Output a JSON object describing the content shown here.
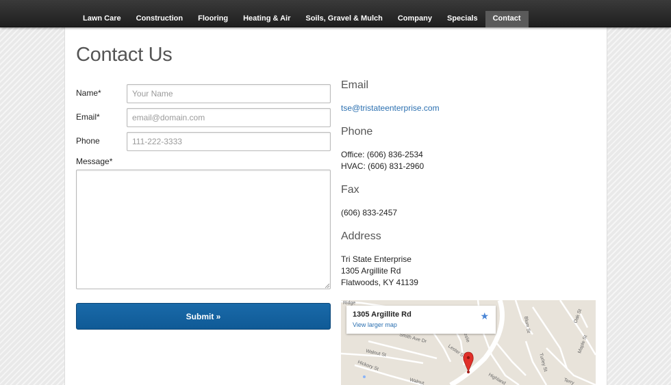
{
  "nav": {
    "items": [
      {
        "label": "Lawn Care"
      },
      {
        "label": "Construction"
      },
      {
        "label": "Flooring"
      },
      {
        "label": "Heating & Air"
      },
      {
        "label": "Soils, Gravel & Mulch"
      },
      {
        "label": "Company"
      },
      {
        "label": "Specials"
      },
      {
        "label": "Contact",
        "active": true
      }
    ]
  },
  "page": {
    "title": "Contact Us"
  },
  "form": {
    "name_label": "Name*",
    "name_placeholder": "Your Name",
    "email_label": "Email*",
    "email_placeholder": "email@domain.com",
    "phone_label": "Phone",
    "phone_placeholder": "111-222-3333",
    "message_label": "Message*",
    "submit_label": "Submit »"
  },
  "info": {
    "email_heading": "Email",
    "email": "tse@tristateenterprise.com",
    "phone_heading": "Phone",
    "office_phone": "Office: (606) 836-2534",
    "hvac_phone": "HVAC: (606) 831-2960",
    "fax_heading": "Fax",
    "fax": "(606) 833-2457",
    "address_heading": "Address",
    "address_name": "Tri State Enterprise",
    "address_street": "1305 Argillite Rd",
    "address_city": "Flatwoods, KY 41139"
  },
  "map": {
    "card_address": "1305 Argillite Rd",
    "view_larger": "View larger map",
    "street_labels": [
      "Ridge",
      "Walnut St",
      "Hickory St",
      "Walnut",
      "Smith Ave Dr",
      "Leslie",
      "Lester St",
      "Highland",
      "Blum St",
      "Turley St",
      "Oak St",
      "Maple St",
      "Terry"
    ]
  },
  "colors": {
    "nav_bg": "#2b2b2b",
    "nav_active": "#5a5a5a",
    "accent_button": "#12609e",
    "link": "#2a6fb0",
    "map_pin": "#e0302a"
  },
  "icons": [
    "star-icon",
    "map-pin-icon",
    "resize-grip-icon"
  ]
}
